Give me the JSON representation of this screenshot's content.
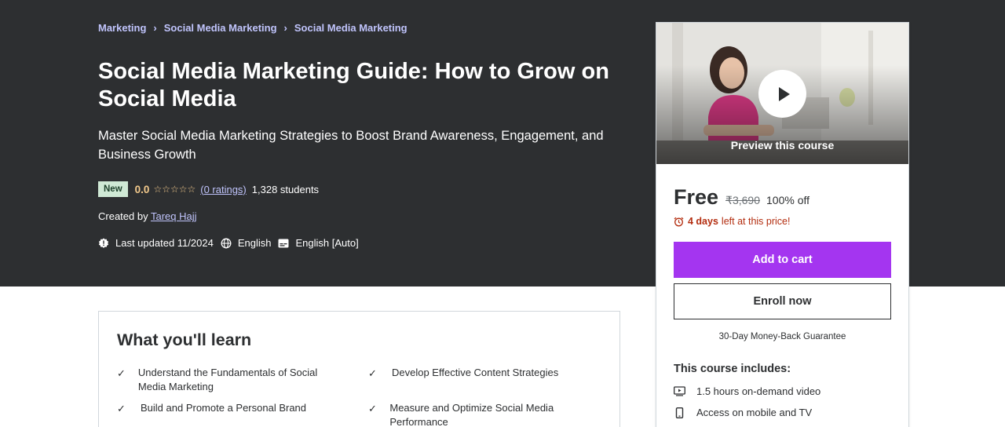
{
  "breadcrumb": [
    "Marketing",
    "Social Media Marketing",
    "Social Media Marketing"
  ],
  "course": {
    "title": "Social Media Marketing Guide: How to Grow on Social Media",
    "subtitle": "Master Social Media Marketing Strategies to Boost Brand Awareness, Engagement, and Business Growth",
    "badge": "New",
    "rating": "0.0",
    "stars_filled": 0,
    "stars_total": 5,
    "ratings_link": "(0 ratings)",
    "students": "1,328 students",
    "created_by_label": "Created by",
    "instructor": "Tareq Hajj",
    "last_updated": "Last updated 11/2024",
    "language": "English",
    "captions": "English [Auto]"
  },
  "sidebar": {
    "preview_label": "Preview this course",
    "price": "Free",
    "original_price": "₹3,690",
    "discount": "100% off",
    "timer_bold": "4 days",
    "timer_rest": "left at this price!",
    "add_to_cart": "Add to cart",
    "enroll_now": "Enroll now",
    "guarantee": "30-Day Money-Back Guarantee",
    "includes_title": "This course includes:",
    "includes": [
      {
        "icon": "video-icon",
        "label": "1.5 hours on-demand video"
      },
      {
        "icon": "mobile-icon",
        "label": "Access on mobile and TV"
      }
    ]
  },
  "learn": {
    "title": "What you'll learn",
    "items": [
      "Understand the Fundamentals of Social Media Marketing",
      "Develop Effective Content Strategies",
      "Build and Promote a Personal Brand",
      "Measure and Optimize Social Media Performance"
    ]
  },
  "colors": {
    "hero_bg": "#2d2f31",
    "link": "#c0c4fc",
    "rating": "#f3ca8c",
    "cart_button": "#a435f0",
    "badge_bg": "#cfe9d5",
    "timer": "#b32d0f"
  }
}
